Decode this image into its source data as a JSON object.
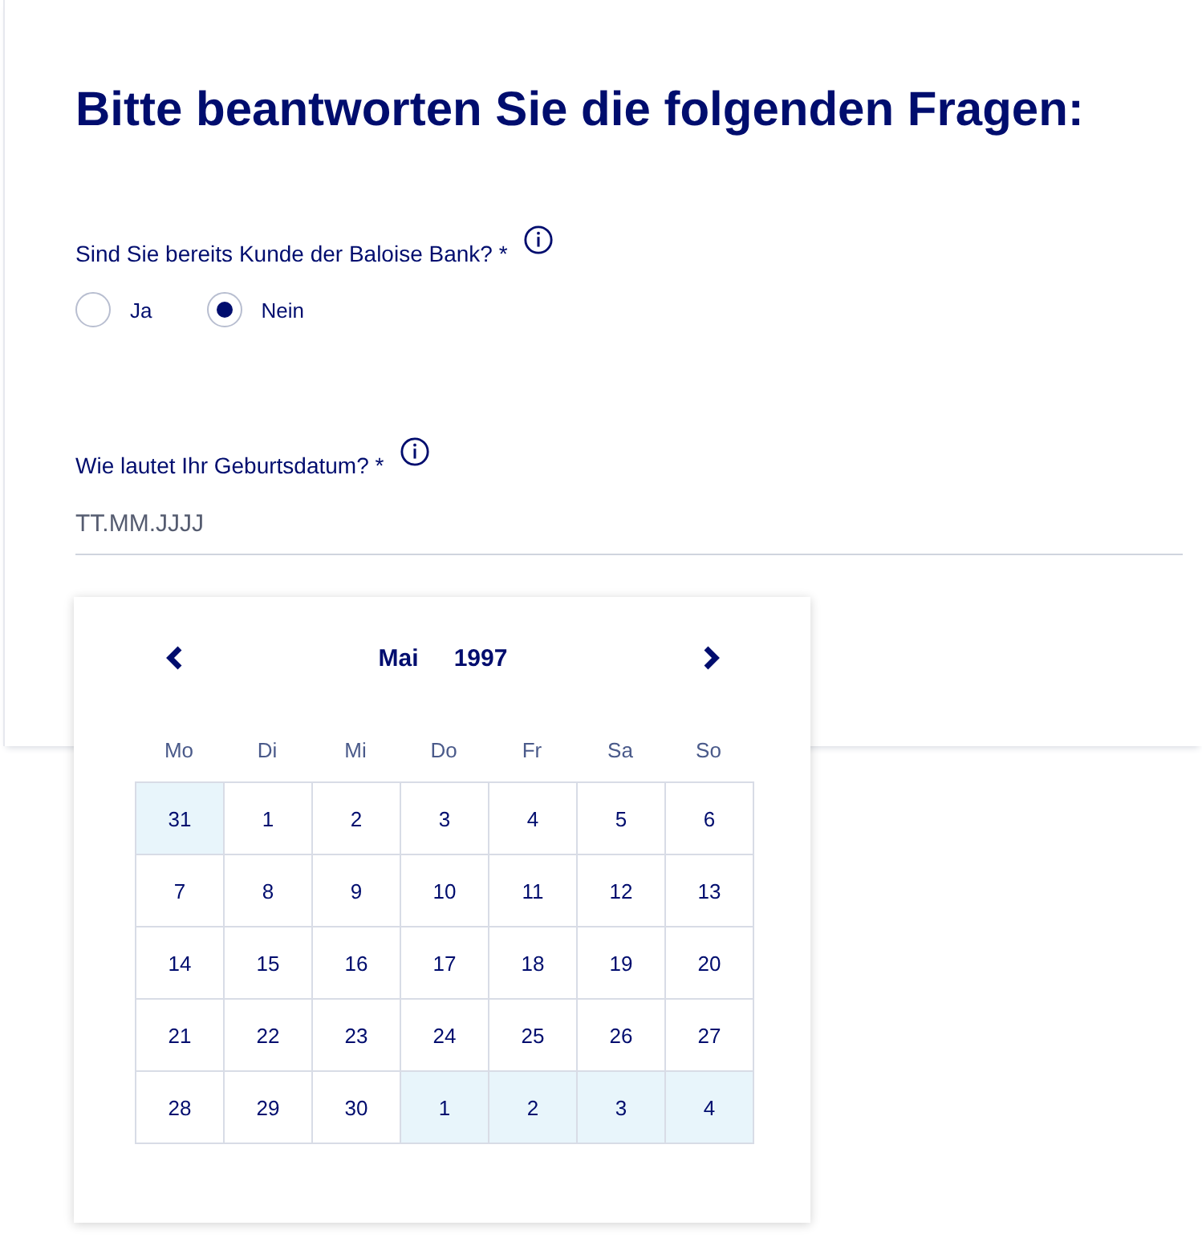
{
  "title": "Bitte beantworten Sie die folgenden Fragen:",
  "customer_question": {
    "label": "Sind Sie bereits Kunde der Baloise Bank? *",
    "options": [
      {
        "label": "Ja",
        "selected": false
      },
      {
        "label": "Nein",
        "selected": true
      }
    ]
  },
  "birthdate_question": {
    "label": "Wie lautet Ihr Geburtsdatum? *",
    "placeholder": "TT.MM.JJJJ"
  },
  "calendar": {
    "month": "Mai",
    "year": "1997",
    "weekdays": [
      "Mo",
      "Di",
      "Mi",
      "Do",
      "Fr",
      "Sa",
      "So"
    ],
    "weeks": [
      [
        {
          "day": "31",
          "other_month": true
        },
        {
          "day": "1",
          "other_month": false
        },
        {
          "day": "2",
          "other_month": false
        },
        {
          "day": "3",
          "other_month": false
        },
        {
          "day": "4",
          "other_month": false
        },
        {
          "day": "5",
          "other_month": false
        },
        {
          "day": "6",
          "other_month": false
        }
      ],
      [
        {
          "day": "7",
          "other_month": false
        },
        {
          "day": "8",
          "other_month": false
        },
        {
          "day": "9",
          "other_month": false
        },
        {
          "day": "10",
          "other_month": false
        },
        {
          "day": "11",
          "other_month": false
        },
        {
          "day": "12",
          "other_month": false
        },
        {
          "day": "13",
          "other_month": false
        }
      ],
      [
        {
          "day": "14",
          "other_month": false
        },
        {
          "day": "15",
          "other_month": false
        },
        {
          "day": "16",
          "other_month": false
        },
        {
          "day": "17",
          "other_month": false
        },
        {
          "day": "18",
          "other_month": false
        },
        {
          "day": "19",
          "other_month": false
        },
        {
          "day": "20",
          "other_month": false
        }
      ],
      [
        {
          "day": "21",
          "other_month": false
        },
        {
          "day": "22",
          "other_month": false
        },
        {
          "day": "23",
          "other_month": false
        },
        {
          "day": "24",
          "other_month": false
        },
        {
          "day": "25",
          "other_month": false
        },
        {
          "day": "26",
          "other_month": false
        },
        {
          "day": "27",
          "other_month": false
        }
      ],
      [
        {
          "day": "28",
          "other_month": false
        },
        {
          "day": "29",
          "other_month": false
        },
        {
          "day": "30",
          "other_month": false
        },
        {
          "day": "1",
          "other_month": true
        },
        {
          "day": "2",
          "other_month": true
        },
        {
          "day": "3",
          "other_month": true
        },
        {
          "day": "4",
          "other_month": true
        }
      ]
    ]
  }
}
